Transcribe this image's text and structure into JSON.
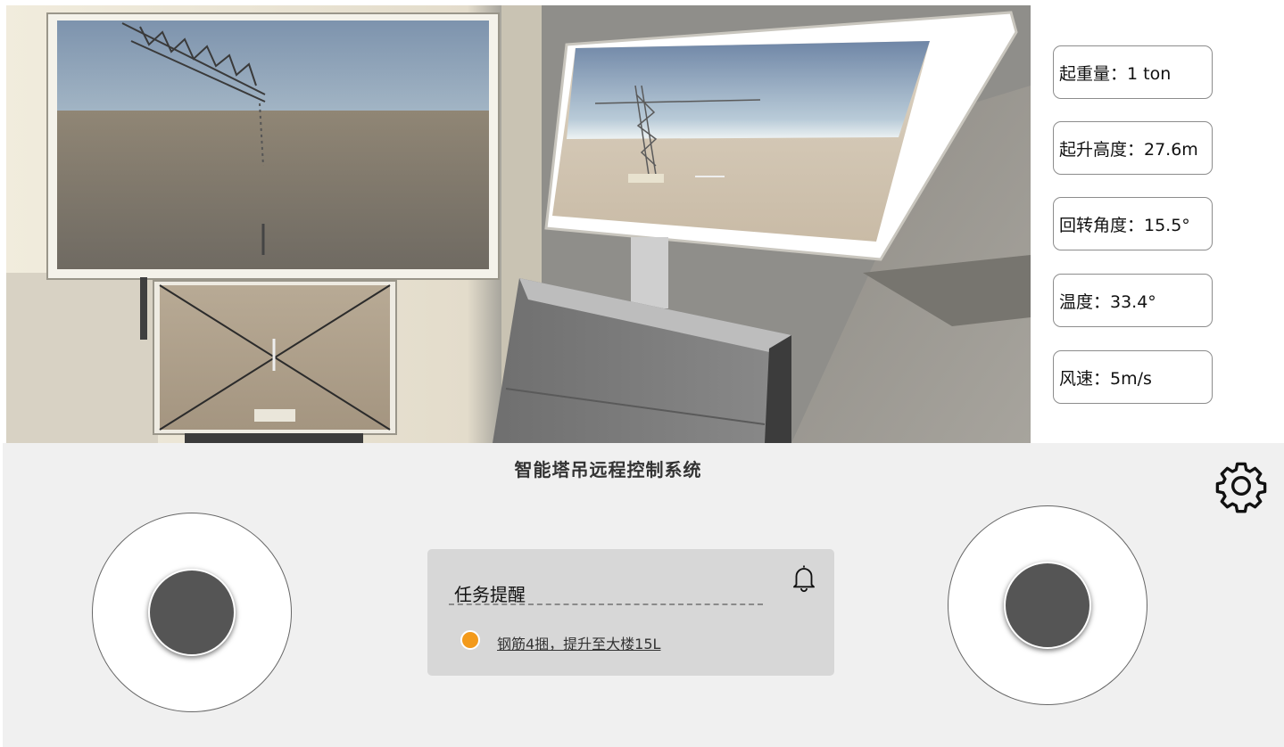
{
  "stats": [
    {
      "text": "起重量：1 ton"
    },
    {
      "text": "起升高度：27.6m"
    },
    {
      "text": "回转角度：15.5°"
    },
    {
      "text": "温度：33.4°"
    },
    {
      "text": "风速：5m/s"
    }
  ],
  "panel": {
    "title": "智能塔吊远程控制系统",
    "settings_icon": "gear-icon",
    "task": {
      "title": "任务提醒",
      "icon": "bell-icon",
      "items": [
        {
          "text": "钢筋4捆，提升至大楼15L",
          "status_color": "#f39a1b"
        }
      ]
    }
  },
  "colors": {
    "panel_bg": "#f0f0f0",
    "knob": "#555555",
    "task_card": "#d7d7d7",
    "status_dot": "#f39a1b"
  }
}
